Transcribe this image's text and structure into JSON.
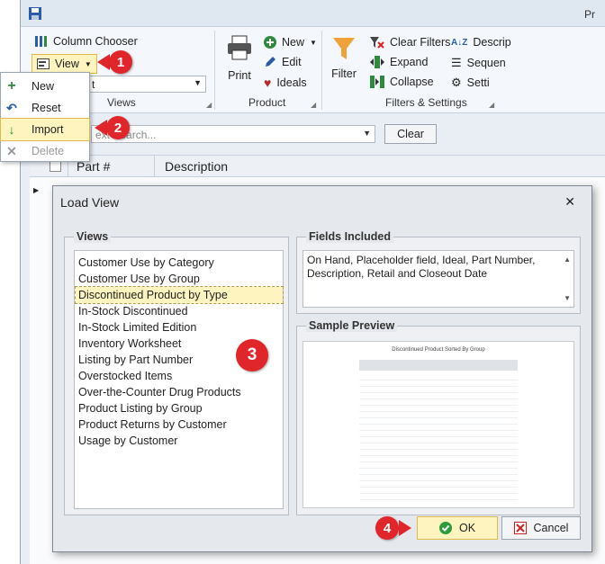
{
  "app": {
    "title_fragment": "Pr",
    "ribbon": {
      "column_chooser": "Column Chooser",
      "view_button": "View",
      "views_group": "Views",
      "search_combo_value": "t",
      "product_group": "Product",
      "print": "Print",
      "new": "New",
      "edit": "Edit",
      "ideals": "Ideals",
      "filter": "Filter",
      "clear_filters": "Clear Filters",
      "expand": "Expand",
      "collapse": "Collapse",
      "filters_group": "Filters & Settings",
      "description_fragment": "Descrip",
      "sequence_fragment": "Sequen",
      "settings_fragment": "Setti"
    },
    "search_placeholder": "ext Search...",
    "clear_button": "Clear",
    "grid_headers": [
      "Part #",
      "Description"
    ]
  },
  "view_menu": {
    "items": [
      {
        "label": "New",
        "icon": "plus-icon",
        "color": "#2e8b3e"
      },
      {
        "label": "Reset",
        "icon": "reset-icon",
        "color": "#2a5caa"
      },
      {
        "label": "Import",
        "icon": "down-arrow-icon",
        "color": "#2e8b3e"
      },
      {
        "label": "Delete",
        "icon": "close-icon",
        "color": "#9a9a9a"
      }
    ]
  },
  "callouts": [
    "1",
    "2",
    "3",
    "4"
  ],
  "dialog": {
    "title": "Load View",
    "views_title": "Views",
    "views": [
      "Customer Use by Category",
      "Customer Use by Group",
      "Discontinued Product by Type",
      "In-Stock Discontinued",
      "In-Stock Limited Edition",
      "Inventory Worksheet",
      "Listing by Part Number",
      "Overstocked Items",
      "Over-the-Counter Drug Products",
      "Product Listing by Group",
      "Product Returns by Customer",
      "Usage by Customer"
    ],
    "selected_view": "Discontinued Product by Type",
    "fields_title": "Fields Included",
    "fields_text": "On Hand, Placeholder field, Ideal, Part Number, Description, Retail and Closeout Date",
    "sample_title": "Sample Preview",
    "preview_heading": "Discontinued Product Sorted By Group",
    "ok": "OK",
    "cancel": "Cancel"
  },
  "colors": {
    "accent_red": "#e1262b",
    "highlight": "#fdf4bf",
    "ok_green": "#2e9b3e"
  }
}
